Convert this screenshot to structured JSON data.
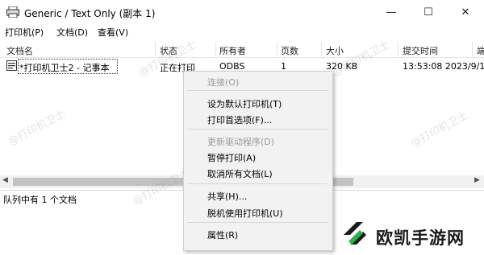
{
  "window": {
    "title": "Generic / Text Only (副本 1)",
    "controls": {
      "minimize": "—",
      "maximize": "☐",
      "close": "✕"
    }
  },
  "menubar": [
    "打印机(P)",
    "文档(D)",
    "查看(V)"
  ],
  "table": {
    "columns": [
      "文档名",
      "状态",
      "所有者",
      "页数",
      "大小",
      "提交时间",
      "端口"
    ],
    "rows": [
      {
        "name": "*打印机卫士2 - 记事本",
        "status": "正在打印",
        "owner": "ODBS",
        "pages": "1",
        "size": "320 KB",
        "submitted": "13:53:08  2023/9/1"
      }
    ]
  },
  "status_bar": "队列中有 1 个文档",
  "context_menu": [
    {
      "label": "连接(O)",
      "enabled": false
    },
    {
      "label": "设为默认打印机(T)",
      "enabled": true
    },
    {
      "label": "打印首选项(F)...",
      "enabled": true
    },
    {
      "label": "更新驱动程序(D)",
      "enabled": false
    },
    {
      "label": "暂停打印(A)",
      "enabled": true
    },
    {
      "label": "取消所有文档(L)",
      "enabled": true
    },
    {
      "label": "共享(H)...",
      "enabled": true
    },
    {
      "label": "脱机使用打印机(U)",
      "enabled": true
    },
    {
      "label": "属性(R)",
      "enabled": true
    }
  ],
  "watermark": "@打印机卫士",
  "brand": {
    "text": "欧凯手游网",
    "color_primary": "#1a1a1a",
    "color_accent": "#2bb24c"
  }
}
